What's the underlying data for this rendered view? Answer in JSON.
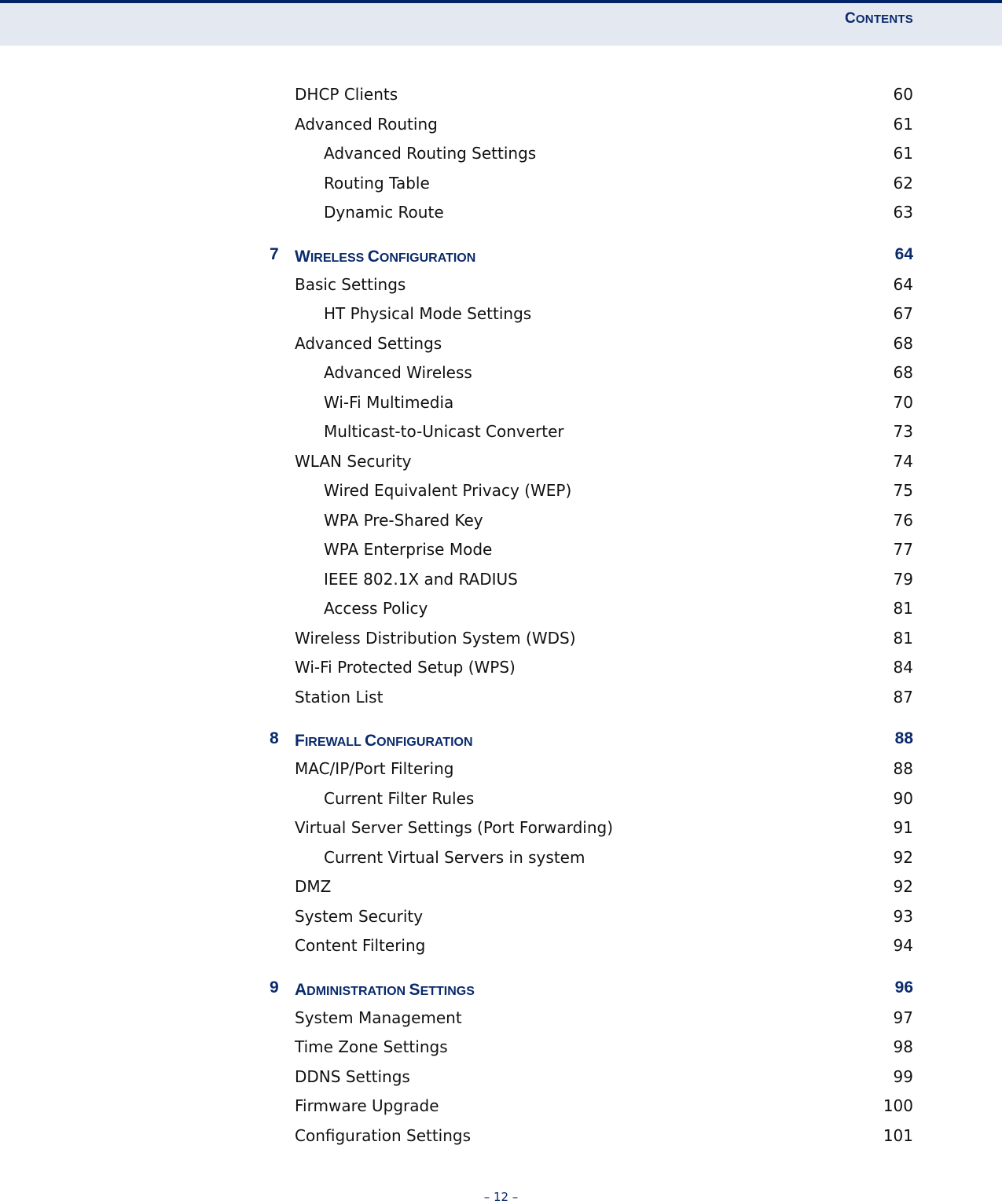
{
  "header": {
    "title": "Contents"
  },
  "entries": [
    {
      "level": 1,
      "label": "DHCP Clients",
      "page": "60"
    },
    {
      "level": 1,
      "label": "Advanced Routing",
      "page": "61"
    },
    {
      "level": 2,
      "label": "Advanced Routing Settings",
      "page": "61"
    },
    {
      "level": 2,
      "label": "Routing Table",
      "page": "62"
    },
    {
      "level": 2,
      "label": "Dynamic Route",
      "page": "63"
    },
    {
      "level": 0,
      "num": "7",
      "label": "Wireless Configuration",
      "page": "64"
    },
    {
      "level": 1,
      "label": "Basic Settings",
      "page": "64"
    },
    {
      "level": 2,
      "label": "HT Physical Mode Settings",
      "page": "67"
    },
    {
      "level": 1,
      "label": "Advanced Settings",
      "page": "68"
    },
    {
      "level": 2,
      "label": "Advanced Wireless",
      "page": "68"
    },
    {
      "level": 2,
      "label": "Wi-Fi Multimedia",
      "page": "70"
    },
    {
      "level": 2,
      "label": "Multicast-to-Unicast Converter",
      "page": "73"
    },
    {
      "level": 1,
      "label": "WLAN Security",
      "page": "74"
    },
    {
      "level": 2,
      "label": "Wired Equivalent Privacy (WEP)",
      "page": "75"
    },
    {
      "level": 2,
      "label": "WPA Pre-Shared Key",
      "page": "76"
    },
    {
      "level": 2,
      "label": "WPA Enterprise Mode",
      "page": "77"
    },
    {
      "level": 2,
      "label": "IEEE 802.1X and RADIUS",
      "page": "79"
    },
    {
      "level": 2,
      "label": "Access Policy",
      "page": "81"
    },
    {
      "level": 1,
      "label": "Wireless Distribution System (WDS)",
      "page": "81"
    },
    {
      "level": 1,
      "label": "Wi-Fi Protected Setup (WPS)",
      "page": "84"
    },
    {
      "level": 1,
      "label": "Station List",
      "page": "87"
    },
    {
      "level": 0,
      "num": "8",
      "label": "Firewall Configuration",
      "page": "88"
    },
    {
      "level": 1,
      "label": "MAC/IP/Port Filtering",
      "page": "88"
    },
    {
      "level": 2,
      "label": "Current Filter Rules",
      "page": "90"
    },
    {
      "level": 1,
      "label": "Virtual Server Settings (Port Forwarding)",
      "page": "91"
    },
    {
      "level": 2,
      "label": "Current Virtual Servers in system",
      "page": "92"
    },
    {
      "level": 1,
      "label": "DMZ",
      "page": "92"
    },
    {
      "level": 1,
      "label": "System Security",
      "page": "93"
    },
    {
      "level": 1,
      "label": "Content Filtering",
      "page": "94"
    },
    {
      "level": 0,
      "num": "9",
      "label": "Administration Settings",
      "page": "96"
    },
    {
      "level": 1,
      "label": "System Management",
      "page": "97"
    },
    {
      "level": 1,
      "label": "Time Zone Settings",
      "page": "98"
    },
    {
      "level": 1,
      "label": "DDNS Settings",
      "page": "99"
    },
    {
      "level": 1,
      "label": "Firmware Upgrade",
      "page": "100"
    },
    {
      "level": 1,
      "label": "Configuration Settings",
      "page": "101"
    }
  ],
  "footer": {
    "page_number": "–  12  –"
  }
}
